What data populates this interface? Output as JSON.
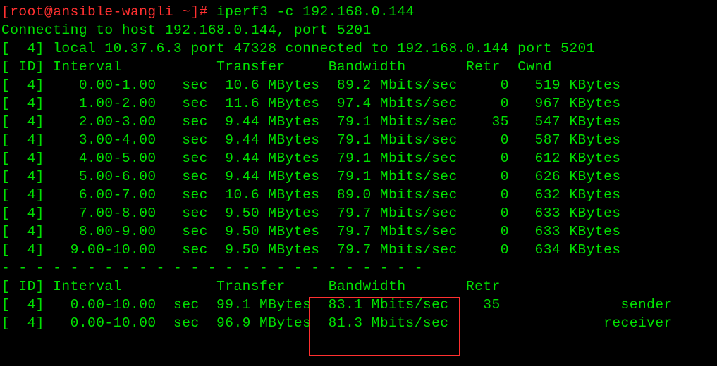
{
  "prompt_user_host": "[root@ansible-wangli ~]#",
  "command": "iperf3 -c 192.168.0.144",
  "connecting_line": "Connecting to host 192.168.0.144, port 5201",
  "local_line": "[  4] local 10.37.6.3 port 47328 connected to 192.168.0.144 port 5201",
  "header": {
    "id": "[ ID]",
    "interval": "Interval",
    "transfer": "Transfer",
    "bandwidth": "Bandwidth",
    "retr": "Retr",
    "cwnd": "Cwnd"
  },
  "rows": [
    {
      "id": "[  4]",
      "interval": "0.00-1.00",
      "unit": "sec",
      "transfer": "10.6 MBytes",
      "bandwidth": "89.2 Mbits/sec",
      "retr": "0",
      "cwnd": "519 KBytes"
    },
    {
      "id": "[  4]",
      "interval": "1.00-2.00",
      "unit": "sec",
      "transfer": "11.6 MBytes",
      "bandwidth": "97.4 Mbits/sec",
      "retr": "0",
      "cwnd": "967 KBytes"
    },
    {
      "id": "[  4]",
      "interval": "2.00-3.00",
      "unit": "sec",
      "transfer": "9.44 MBytes",
      "bandwidth": "79.1 Mbits/sec",
      "retr": "35",
      "cwnd": "547 KBytes"
    },
    {
      "id": "[  4]",
      "interval": "3.00-4.00",
      "unit": "sec",
      "transfer": "9.44 MBytes",
      "bandwidth": "79.1 Mbits/sec",
      "retr": "0",
      "cwnd": "587 KBytes"
    },
    {
      "id": "[  4]",
      "interval": "4.00-5.00",
      "unit": "sec",
      "transfer": "9.44 MBytes",
      "bandwidth": "79.1 Mbits/sec",
      "retr": "0",
      "cwnd": "612 KBytes"
    },
    {
      "id": "[  4]",
      "interval": "5.00-6.00",
      "unit": "sec",
      "transfer": "9.44 MBytes",
      "bandwidth": "79.1 Mbits/sec",
      "retr": "0",
      "cwnd": "626 KBytes"
    },
    {
      "id": "[  4]",
      "interval": "6.00-7.00",
      "unit": "sec",
      "transfer": "10.6 MBytes",
      "bandwidth": "89.0 Mbits/sec",
      "retr": "0",
      "cwnd": "632 KBytes"
    },
    {
      "id": "[  4]",
      "interval": "7.00-8.00",
      "unit": "sec",
      "transfer": "9.50 MBytes",
      "bandwidth": "79.7 Mbits/sec",
      "retr": "0",
      "cwnd": "633 KBytes"
    },
    {
      "id": "[  4]",
      "interval": "8.00-9.00",
      "unit": "sec",
      "transfer": "9.50 MBytes",
      "bandwidth": "79.7 Mbits/sec",
      "retr": "0",
      "cwnd": "633 KBytes"
    },
    {
      "id": "[  4]",
      "interval": "9.00-10.00",
      "unit": "sec",
      "transfer": "9.50 MBytes",
      "bandwidth": "79.7 Mbits/sec",
      "retr": "0",
      "cwnd": "634 KBytes"
    }
  ],
  "separator": "- - - - - - - - - - - - - - - - - - - - - - - - -",
  "summary_header": {
    "id": "[ ID]",
    "interval": "Interval",
    "transfer": "Transfer",
    "bandwidth": "Bandwidth",
    "retr": "Retr"
  },
  "summary": [
    {
      "id": "[  4]",
      "interval": "0.00-10.00",
      "unit": "sec",
      "transfer": "99.1 MBytes",
      "bandwidth": "83.1 Mbits/sec",
      "retr": "35",
      "role": "sender"
    },
    {
      "id": "[  4]",
      "interval": "0.00-10.00",
      "unit": "sec",
      "transfer": "96.9 MBytes",
      "bandwidth": "81.3 Mbits/sec",
      "retr": "",
      "role": "receiver"
    }
  ]
}
